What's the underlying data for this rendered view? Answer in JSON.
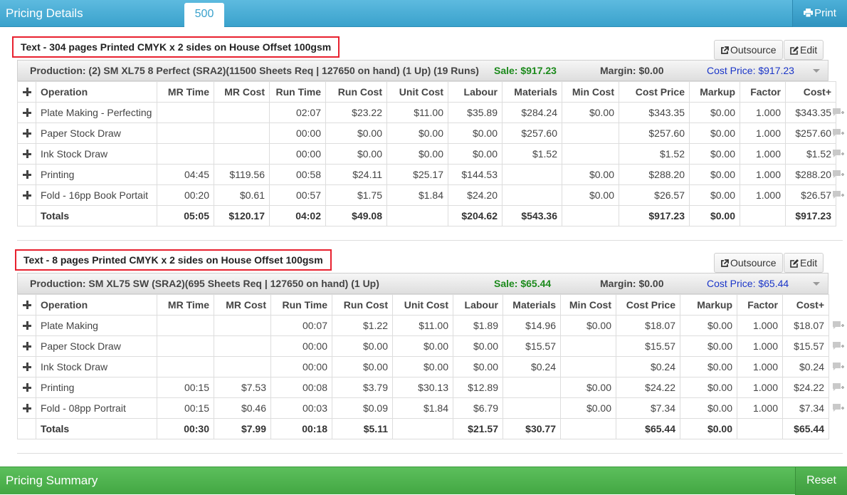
{
  "header": {
    "title": "Pricing Details",
    "tab": "500",
    "print_label": "Print"
  },
  "footer": {
    "title": "Pricing Summary",
    "reset_label": "Reset"
  },
  "columns": [
    "Operation",
    "MR Time",
    "MR Cost",
    "Run Time",
    "Run Cost",
    "Unit Cost",
    "Labour",
    "Materials",
    "Min Cost",
    "Cost Price",
    "Markup",
    "Factor",
    "Cost+"
  ],
  "sections": [
    {
      "title": "Text - 304 pages Printed CMYK x 2 sides on House Offset 100gsm",
      "outsource_label": "Outsource",
      "edit_label": "Edit",
      "production": "Production: (2) SM XL75 8 Perfect (SRA2)(11500 Sheets Req | 127650 on hand) (1 Up) (19 Runs)",
      "sale": "Sale: $917.23",
      "margin": "Margin: $0.00",
      "cost_price": "Cost Price: $917.23",
      "rows": [
        [
          "Plate Making - Perfecting",
          "",
          "",
          "02:07",
          "$23.22",
          "$11.00",
          "$35.89",
          "$284.24",
          "$0.00",
          "$343.35",
          "$0.00",
          "1.000",
          "$343.35"
        ],
        [
          "Paper Stock Draw",
          "",
          "",
          "00:00",
          "$0.00",
          "$0.00",
          "$0.00",
          "$257.60",
          "",
          "$257.60",
          "$0.00",
          "1.000",
          "$257.60"
        ],
        [
          "Ink Stock Draw",
          "",
          "",
          "00:00",
          "$0.00",
          "$0.00",
          "$0.00",
          "$1.52",
          "",
          "$1.52",
          "$0.00",
          "1.000",
          "$1.52"
        ],
        [
          "Printing",
          "04:45",
          "$119.56",
          "00:58",
          "$24.11",
          "$25.17",
          "$144.53",
          "",
          "$0.00",
          "$288.20",
          "$0.00",
          "1.000",
          "$288.20"
        ],
        [
          "Fold - 16pp Book Portait",
          "00:20",
          "$0.61",
          "00:57",
          "$1.75",
          "$1.84",
          "$24.20",
          "",
          "$0.00",
          "$26.57",
          "$0.00",
          "1.000",
          "$26.57"
        ]
      ],
      "totals": [
        "Totals",
        "05:05",
        "$120.17",
        "04:02",
        "$49.08",
        "",
        "$204.62",
        "$543.36",
        "",
        "$917.23",
        "$0.00",
        "",
        "$917.23"
      ]
    },
    {
      "title": "Text - 8 pages Printed CMYK x 2 sides on House Offset 100gsm",
      "outsource_label": "Outsource",
      "edit_label": "Edit",
      "production": "Production: SM XL75 SW (SRA2)(695 Sheets Req | 127650 on hand) (1 Up)",
      "sale": "Sale: $65.44",
      "margin": "Margin: $0.00",
      "cost_price": "Cost Price: $65.44",
      "rows": [
        [
          "Plate Making",
          "",
          "",
          "00:07",
          "$1.22",
          "$11.00",
          "$1.89",
          "$14.96",
          "$0.00",
          "$18.07",
          "$0.00",
          "1.000",
          "$18.07"
        ],
        [
          "Paper Stock Draw",
          "",
          "",
          "00:00",
          "$0.00",
          "$0.00",
          "$0.00",
          "$15.57",
          "",
          "$15.57",
          "$0.00",
          "1.000",
          "$15.57"
        ],
        [
          "Ink Stock Draw",
          "",
          "",
          "00:00",
          "$0.00",
          "$0.00",
          "$0.00",
          "$0.24",
          "",
          "$0.24",
          "$0.00",
          "1.000",
          "$0.24"
        ],
        [
          "Printing",
          "00:15",
          "$7.53",
          "00:08",
          "$3.79",
          "$30.13",
          "$12.89",
          "",
          "$0.00",
          "$24.22",
          "$0.00",
          "1.000",
          "$24.22"
        ],
        [
          "Fold - 08pp Portrait",
          "00:15",
          "$0.46",
          "00:03",
          "$0.09",
          "$1.84",
          "$6.79",
          "",
          "$0.00",
          "$7.34",
          "$0.00",
          "1.000",
          "$7.34"
        ]
      ],
      "totals": [
        "Totals",
        "00:30",
        "$7.99",
        "00:18",
        "$5.11",
        "",
        "$21.57",
        "$30.77",
        "",
        "$65.44",
        "$0.00",
        "",
        "$65.44"
      ]
    }
  ]
}
